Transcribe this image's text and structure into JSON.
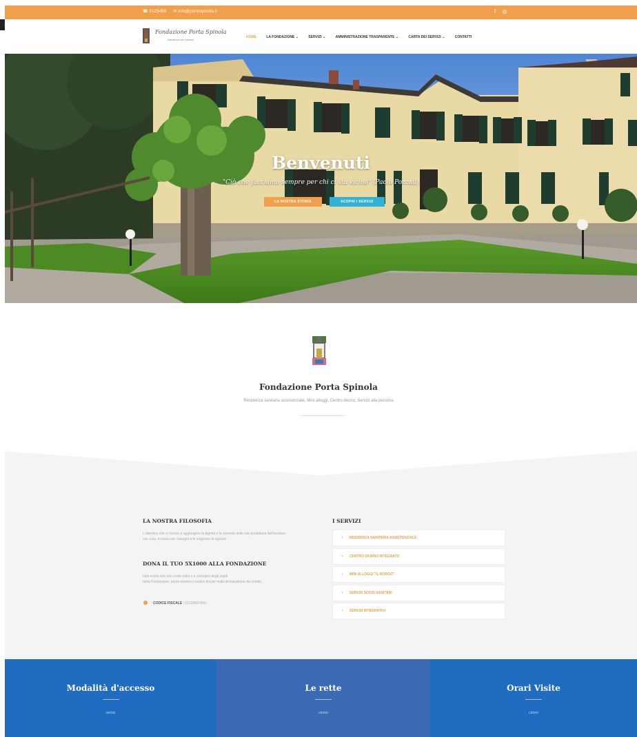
{
  "topbar": {
    "phone": "☎ 0123456",
    "email": "✉ info@portaspinola.it",
    "social": [
      "f",
      "◎"
    ]
  },
  "header": {
    "side_button": "≡",
    "logo_name": "Fondazione Porta Spinola",
    "logo_sub": "residenze per anziani",
    "nav": [
      {
        "label": "HOME"
      },
      {
        "label": "LA FONDAZIONE ⌄"
      },
      {
        "label": "SERVIZI ⌄"
      },
      {
        "label": "AMMINISTRAZIONE TRASPARENTE ⌄"
      },
      {
        "label": "CARTA DEI SERVIZI ⌄"
      },
      {
        "label": "CONTATTI"
      }
    ]
  },
  "hero": {
    "title": "Benvenuti",
    "quote": "\"Ciò che facciamo sempre per chi ci sta vicino\" (Paolo Pozzati)",
    "button_primary": "LA NOSTRA STORIA",
    "button_secondary": "SCOPRI I SERVIZI"
  },
  "intro": {
    "title": "Fondazione Porta Spinola",
    "subtitle": "Residenza sanitaria assistenziale, Mini alloggi, Centro diurno, Servizi alla persona"
  },
  "philosophy": {
    "title": "LA NOSTRA FILOSOFIA",
    "text": [
      "L'obiettivo che ci muove è aggiungere la dignità e la serenità della vita quotidiana dell'anziano",
      "con cura, in linea con i bisogni e le esigenze di ognuno."
    ]
  },
  "donation": {
    "title": "DONA IL TUO 5X1000 ALLA FONDAZIONE",
    "text": [
      "Una scelta che non costa nulla e a sostegno degli ospiti",
      "della Fondazione: basta inserire il codice fiscale nella dichiarazione dei redditi."
    ],
    "fiscal_label": "CODICE FISCALE",
    "fiscal_value": "01234567890"
  },
  "services": {
    "title": "I SERVIZI",
    "items": [
      {
        "label": "RESIDENZA SANITARIA ASSISTENZIALE"
      },
      {
        "label": "CENTRO DIURNO INTEGRATO"
      },
      {
        "label": "MINI ALLOGGI \"IL BORGO\""
      },
      {
        "label": "SERVIZI SOCIO-SANITARI"
      },
      {
        "label": "SERVIZI INTEGRATIVI"
      }
    ]
  },
  "footer": [
    {
      "title": "Modalità d'accesso",
      "link": "LEGGI"
    },
    {
      "title": "Le rette",
      "link": "LEGGI"
    },
    {
      "title": "Orari Visite",
      "link": "LEGGI"
    }
  ],
  "colors": {
    "accent": "#f0a04b",
    "secondary_button": "#2fb1d8",
    "footer_blue_1": "#1f6cc0",
    "footer_blue_2": "#3a6bb4",
    "footer_blue_3": "#1f6cc0"
  }
}
